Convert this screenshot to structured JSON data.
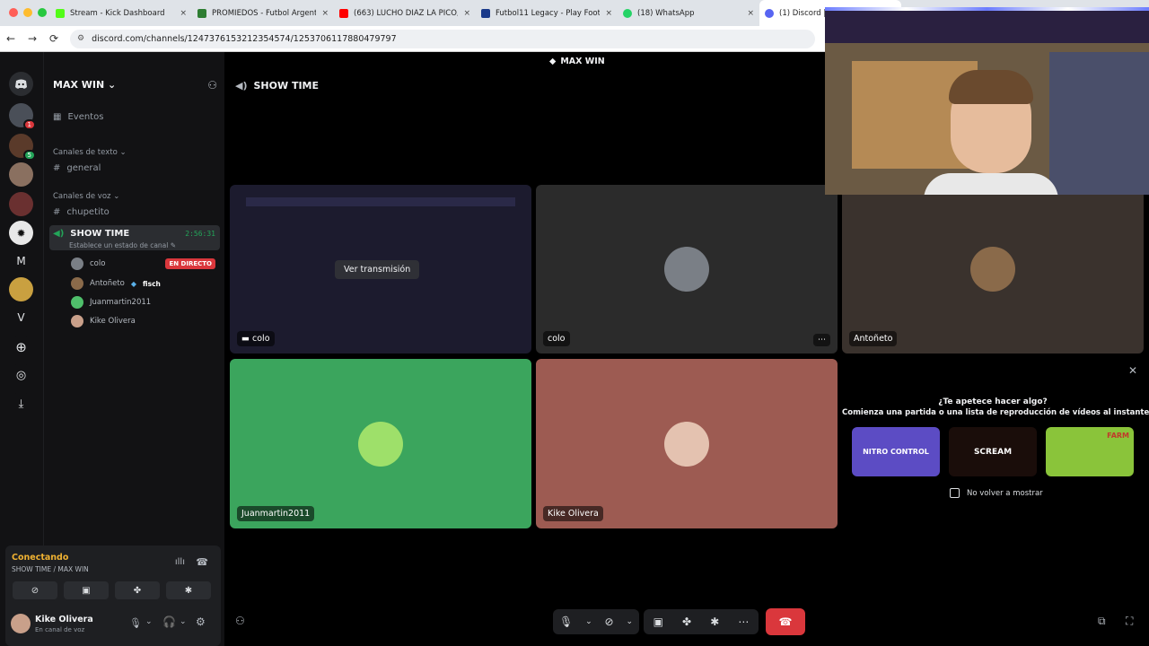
{
  "browser": {
    "tabs": [
      {
        "label": "Stream - Kick Dashboard",
        "fav": "#53fc18"
      },
      {
        "label": "PROMIEDOS - Futbol Argent",
        "fav": "#2e7d32"
      },
      {
        "label": "(663) LUCHO DÍAZ LA PICÓ,",
        "fav": "#ff0000"
      },
      {
        "label": "Futbol11 Legacy - Play Footb",
        "fav": "#1a3a8a"
      },
      {
        "label": "(18) WhatsApp",
        "fav": "#25d366"
      },
      {
        "label": "(1) Discord | S",
        "fav": "#5865f2"
      }
    ],
    "url": "discord.com/channels/1247376153212354574/1253706117880479797",
    "close_glyph": "×",
    "nav": {
      "back": "←",
      "forward": "→",
      "reload": "⟳"
    }
  },
  "server": {
    "name": "MAX WIN",
    "events": "Eventos",
    "text_category": "Canales de texto",
    "text_channel": "general",
    "voice_category": "Canales de voz",
    "voice_channel_1": "chupetito",
    "active_channel": "SHOW TIME",
    "active_timer": "2:56:31",
    "status_hint": "Establece un estado de canal",
    "members": [
      {
        "name": "colo",
        "color": "#7a7f86"
      },
      {
        "name": "Antoñeto",
        "color": "#8a6a4a"
      },
      {
        "name": "Juanmartin2011",
        "color": "#4fbf6b"
      },
      {
        "name": "Kike Olivera",
        "color": "#c9a08a"
      }
    ],
    "live_badge": "EN DIRECTO",
    "member_tag": "fisch"
  },
  "guild_letters": [
    "M",
    "V"
  ],
  "guild_badges": [
    "1",
    "5"
  ],
  "voice_status": {
    "title": "Conectando",
    "subtitle": "SHOW TIME / MAX WIN"
  },
  "user": {
    "name": "Kike Olivera",
    "status": "En canal de voz"
  },
  "stage": {
    "top_label": "MAX WIN",
    "channel_header": "SHOW TIME",
    "watch_stream": "Ver transmisión",
    "tiles": [
      {
        "name": "colo"
      },
      {
        "name": "colo"
      },
      {
        "name": "Antoñeto"
      },
      {
        "name": "Juanmartin2011"
      },
      {
        "name": "Kike Olivera"
      }
    ]
  },
  "activity": {
    "question": "¿Te apetece hacer algo?",
    "description": "Comienza una partida o una lista de reproducción de vídeos al instante.",
    "dont_show": "No volver a mostrar",
    "games": [
      "NITRO CONTROL",
      "SCREAM",
      "FARM"
    ]
  },
  "colors": {
    "accent": "#5865f2",
    "green_tile": "#3ba55d",
    "rose_tile": "#9d5b52",
    "danger": "#da373c",
    "connecting": "#f0b232"
  }
}
